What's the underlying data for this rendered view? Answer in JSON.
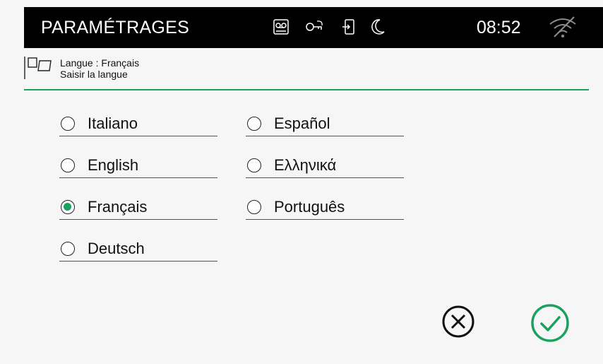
{
  "topbar": {
    "title": "PARAMÉTRAGES",
    "time": "08:52",
    "icons": [
      "voicemail-icon",
      "key-icon",
      "door-entry-icon",
      "moon-icon",
      "wifi-off-icon"
    ]
  },
  "header": {
    "line1": "Langue : Français",
    "line2": "Saisir la langue",
    "icon": "flag-icon"
  },
  "languages": [
    {
      "label": "Italiano",
      "selected": false
    },
    {
      "label": "English",
      "selected": false
    },
    {
      "label": "Français",
      "selected": true
    },
    {
      "label": "Deutsch",
      "selected": false
    },
    {
      "label": "Español",
      "selected": false
    },
    {
      "label": "Ελληνικά",
      "selected": false
    },
    {
      "label": "Português",
      "selected": false
    }
  ],
  "actions": {
    "cancel_icon": "cancel-circle-icon",
    "confirm_icon": "confirm-check-icon"
  },
  "colors": {
    "accent": "#1aa15f",
    "topbar_bg": "#000000",
    "background": "#f6f6f6"
  }
}
